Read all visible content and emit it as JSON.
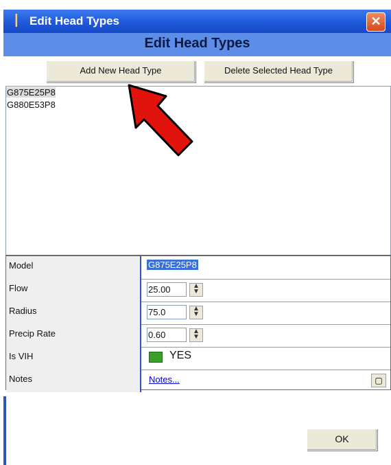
{
  "window": {
    "title": "Edit Head Types",
    "close_label": "✕"
  },
  "header": {
    "title": "Edit Head Types"
  },
  "toolbar": {
    "add_label": "Add New Head Type",
    "delete_label": "Delete Selected Head Type"
  },
  "head_types": [
    {
      "name": "G875E25P8",
      "selected": true
    },
    {
      "name": "G880E53P8",
      "selected": false
    }
  ],
  "properties": {
    "model": {
      "label": "Model",
      "value": "G875E25P8"
    },
    "flow": {
      "label": "Flow",
      "value": "25.00"
    },
    "radius": {
      "label": "Radius",
      "value": "75.0"
    },
    "precip_rate": {
      "label": "Precip Rate",
      "value": "0.60"
    },
    "is_vih": {
      "label": "Is VIH",
      "value": "YES"
    },
    "notes": {
      "label": "Notes",
      "value": "Notes..."
    }
  },
  "footer": {
    "ok_label": "OK"
  },
  "colors": {
    "titlebar": "#1e56d8",
    "header_band": "#5c8ee8",
    "vih_indicator": "#3aa02a",
    "annotation_arrow": "#e0140c"
  },
  "icons": {
    "title": "pin-icon",
    "close": "close-icon",
    "spin": "spinner-icon",
    "notes_button": "ellipsis-icon",
    "annotation": "red-arrow-icon"
  }
}
